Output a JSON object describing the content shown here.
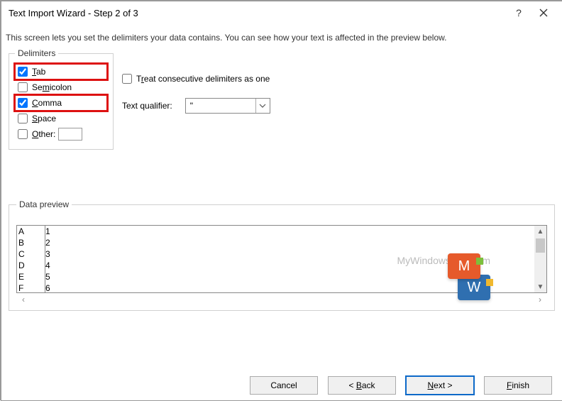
{
  "window": {
    "title": "Text Import Wizard - Step 2 of 3"
  },
  "description": "This screen lets you set the delimiters your data contains.  You can see how your text is affected in the preview below.",
  "delimiters": {
    "legend": "Delimiters",
    "tab": {
      "label": "Tab",
      "checked": true
    },
    "semicolon": {
      "label": "Semicolon",
      "checked": false
    },
    "comma": {
      "label": "Comma",
      "checked": true
    },
    "space": {
      "label": "Space",
      "checked": false
    },
    "other": {
      "label": "Other:",
      "checked": false,
      "value": ""
    }
  },
  "options": {
    "treat_consecutive": {
      "label": "Treat consecutive delimiters as one",
      "checked": false
    },
    "qualifier_label": "Text qualifier:",
    "qualifier_value": "\""
  },
  "preview": {
    "legend": "Data preview",
    "rows": [
      {
        "c1": "A",
        "c2": "1"
      },
      {
        "c1": "B",
        "c2": "2"
      },
      {
        "c1": "C",
        "c2": "3"
      },
      {
        "c1": "D",
        "c2": "4"
      },
      {
        "c1": "E",
        "c2": "5"
      },
      {
        "c1": "F",
        "c2": "6"
      }
    ]
  },
  "buttons": {
    "cancel": "Cancel",
    "back": "Back",
    "next": "Next",
    "finish": "Finish"
  },
  "watermark": "MyWindowsHub.com"
}
